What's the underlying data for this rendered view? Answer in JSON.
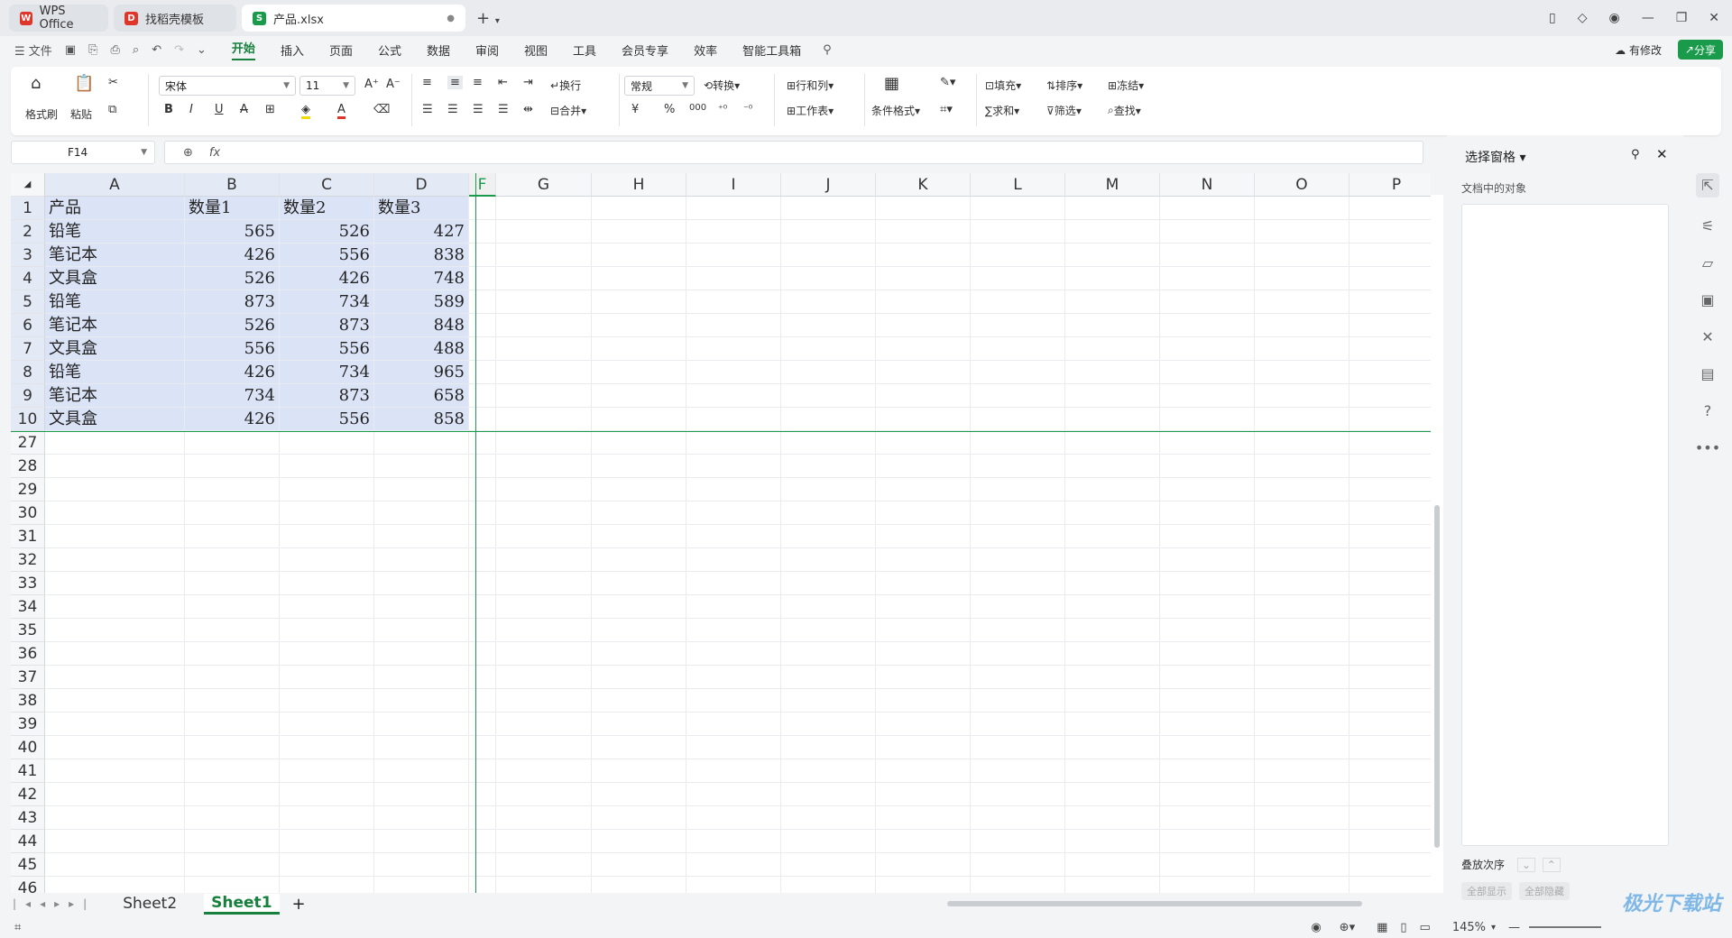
{
  "tabs": [
    {
      "label": "WPS Office",
      "color": "#e0362a"
    },
    {
      "label": "找稻壳模板",
      "color": "#e0362a"
    },
    {
      "label": "产品.xlsx",
      "color": "#1a9b4b"
    }
  ],
  "menu": {
    "file": "文件",
    "items": [
      "开始",
      "插入",
      "页面",
      "公式",
      "数据",
      "审阅",
      "视图",
      "工具",
      "会员专享",
      "效率",
      "智能工具箱"
    ],
    "modified": "有修改",
    "share": "分享"
  },
  "ribbon": {
    "format_painter": "格式刷",
    "paste": "粘贴",
    "font": "宋体",
    "size": "11",
    "wrap": "换行",
    "merge": "合并",
    "number_format": "常规",
    "convert": "转换",
    "rowcol": "行和列",
    "worksheet": "工作表",
    "cond_format": "条件格式",
    "fill": "填充",
    "sort": "排序",
    "freeze": "冻结",
    "sum": "求和",
    "filter": "筛选",
    "find": "查找",
    "currency": "¥",
    "percent": "%",
    "thousands": "000"
  },
  "formula": {
    "name_box": "F14",
    "fx": "fx"
  },
  "columns": [
    "A",
    "B",
    "C",
    "D",
    "F",
    "G",
    "H",
    "I",
    "J",
    "K",
    "L",
    "M",
    "N",
    "O",
    "P"
  ],
  "rows_top": [
    "1",
    "2",
    "3",
    "4",
    "5",
    "6",
    "7",
    "8",
    "9",
    "10"
  ],
  "rows_bottom": [
    "27",
    "28",
    "29",
    "30",
    "31",
    "32",
    "33",
    "34",
    "35",
    "36",
    "37",
    "38",
    "39",
    "40",
    "41",
    "42",
    "43",
    "44",
    "45",
    "46"
  ],
  "table": {
    "header": [
      "产品",
      "数量1",
      "数量2",
      "数量3"
    ],
    "rows": [
      [
        "铅笔",
        "565",
        "526",
        "427"
      ],
      [
        "笔记本",
        "426",
        "556",
        "838"
      ],
      [
        "文具盒",
        "526",
        "426",
        "748"
      ],
      [
        "铅笔",
        "873",
        "734",
        "589"
      ],
      [
        "笔记本",
        "526",
        "873",
        "848"
      ],
      [
        "文具盒",
        "556",
        "556",
        "488"
      ],
      [
        "铅笔",
        "426",
        "734",
        "965"
      ],
      [
        "笔记本",
        "734",
        "873",
        "658"
      ],
      [
        "文具盒",
        "426",
        "556",
        "858"
      ]
    ]
  },
  "sheets": [
    "Sheet2",
    "Sheet1"
  ],
  "active_sheet": "Sheet1",
  "panel": {
    "title": "选择窗格",
    "subtitle": "文档中的对象",
    "order": "叠放次序",
    "show_all": "全部显示",
    "hide_all": "全部隐藏"
  },
  "status": {
    "zoom": "145%"
  },
  "watermark": "极光下载站"
}
